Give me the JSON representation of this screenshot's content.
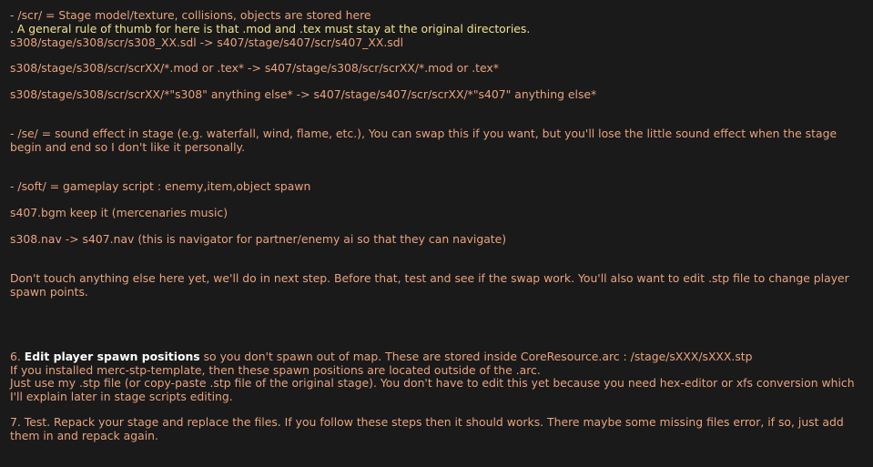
{
  "scr": {
    "heading": "- /scr/ = Stage model/texture, collisions, objects are stored here",
    "rule": ". A general rule of thumb for here is that .mod and .tex must stay at the original directories.",
    "line1": "s308/stage/s308/scr/s308_XX.sdl -> s407/stage/s407/scr/s407_XX.sdl",
    "line2": "s308/stage/s308/scr/scrXX/*.mod or .tex* -> s407/stage/s308/scr/scrXX/*.mod or .tex*",
    "line3": "s308/stage/s308/scr/scrXX/*\"s308\" anything else* -> s407/stage/s407/scr/scrXX/*\"s407\" anything else*"
  },
  "se": {
    "text": "- /se/ = sound effect in stage (e.g. waterfall, wind, flame, etc.), You can swap this if you want, but you'll lose the little sound effect when the stage begin and end so I don't like it personally."
  },
  "soft": {
    "heading": "- /soft/ = gameplay script : enemy,item,object spawn",
    "bgm": "s407.bgm keep it (mercenaries music)",
    "nav": "s308.nav -> s407.nav (this is navigator for partner/enemy ai so that they can navigate)"
  },
  "dont_touch": "Don't touch anything else here yet, we'll do in next step. Before that, test and see if the swap work. You'll also want to edit .stp file to change player spawn points.",
  "step6": {
    "prefix": "6. ",
    "bold": "Edit player spawn positions",
    "rest": " so you don't spawn out of map. These are stored inside CoreResource.arc : /stage/sXXX/sXXX.stp",
    "line2": "If you installed merc-stp-template, then these spawn positions are located outside of the .arc.",
    "line3": "Just use my .stp file (or copy-paste .stp file of the original stage). You don't have to edit this yet because you need hex-editor or xfs conversion which I'll explain later in stage scripts editing."
  },
  "step7": {
    "text": "7. Test. Repack your stage and replace the files. If you follow these steps then it should works. There maybe some missing files error, if so, just add them in and repack again."
  },
  "colors": {
    "background": "#1a1a1a",
    "text": "#e8a37f",
    "highlight": "#f1e28a"
  }
}
